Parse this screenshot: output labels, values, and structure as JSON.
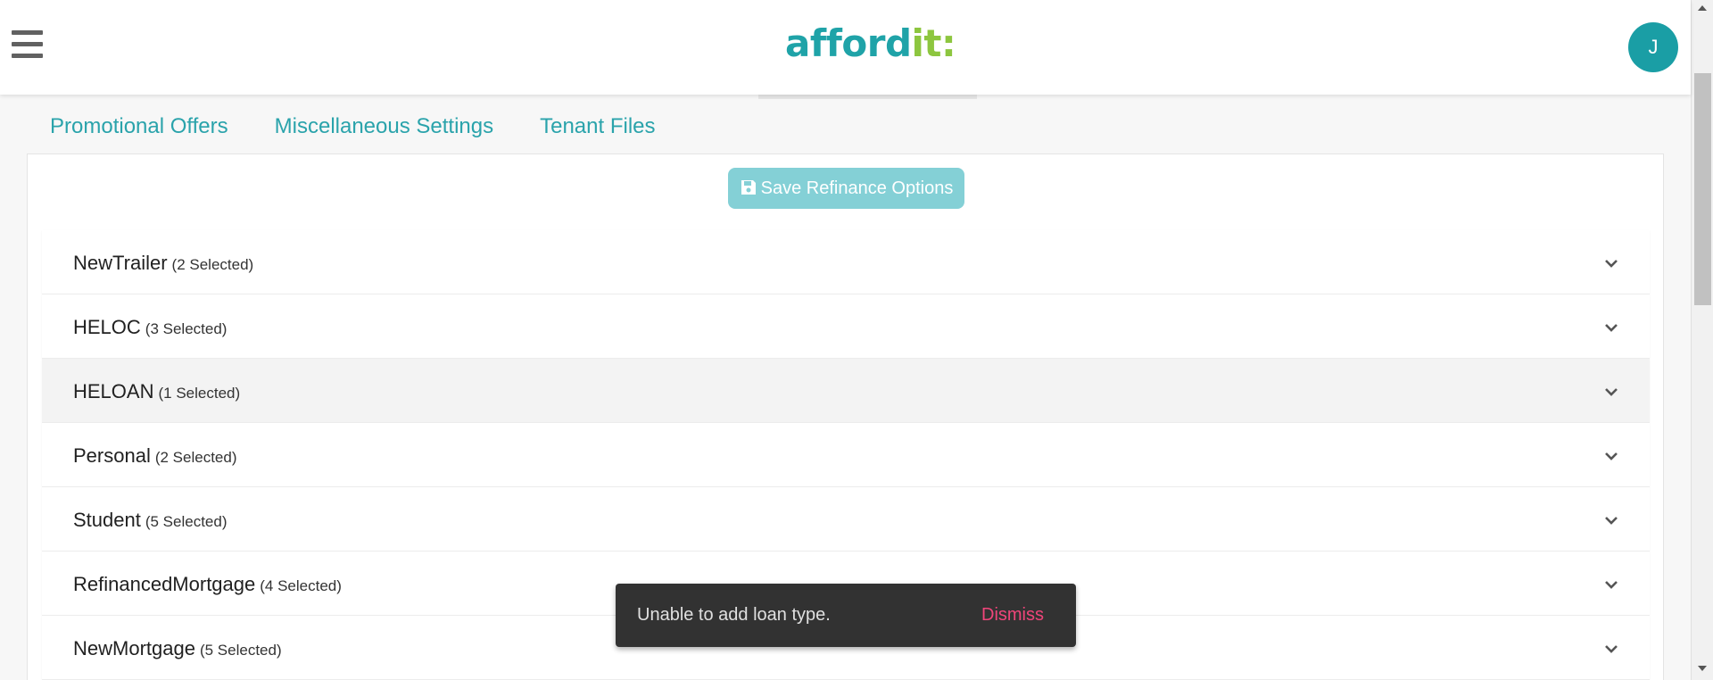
{
  "header": {
    "logo_text_main": "afford",
    "logo_text_accent": "it:",
    "avatar_initial": "J"
  },
  "tabs": [
    {
      "label": "Promotional Offers"
    },
    {
      "label": "Miscellaneous Settings"
    },
    {
      "label": "Tenant Files"
    }
  ],
  "toolbar": {
    "save_label": "Save Refinance Options",
    "save_icon": "floppy-disk-icon"
  },
  "loan_types": [
    {
      "name": "NewTrailer",
      "count": "(2 Selected)"
    },
    {
      "name": "HELOC",
      "count": "(3 Selected)"
    },
    {
      "name": "HELOAN",
      "count": "(1 Selected)"
    },
    {
      "name": "Personal",
      "count": "(2 Selected)"
    },
    {
      "name": "Student",
      "count": "(5 Selected)"
    },
    {
      "name": "RefinancedMortgage",
      "count": "(4 Selected)"
    },
    {
      "name": "NewMortgage",
      "count": "(5 Selected)"
    }
  ],
  "snackbar": {
    "message": "Unable to add loan type.",
    "action": "Dismiss"
  },
  "colors": {
    "brand_teal": "#1fa3a8",
    "brand_green": "#8dc63f",
    "tab_text": "#2aa3ab",
    "save_button": "#84d0d6",
    "dismiss": "#f0457a"
  }
}
